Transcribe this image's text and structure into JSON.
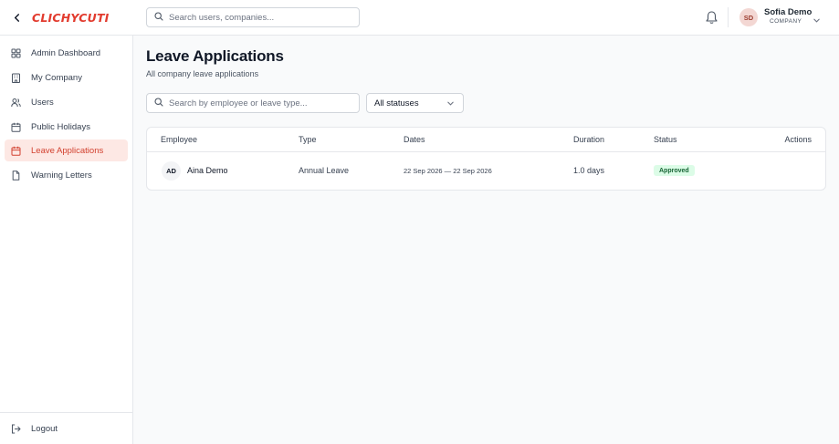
{
  "header": {
    "logo_text": "CLICHYCUTI",
    "search_placeholder": "Search users, companies...",
    "user": {
      "initials": "SD",
      "name": "Sofia Demo",
      "role": "COMPANY"
    }
  },
  "sidebar": {
    "items": [
      {
        "label": "Admin Dashboard",
        "icon": "dashboard-icon"
      },
      {
        "label": "My Company",
        "icon": "building-icon"
      },
      {
        "label": "Users",
        "icon": "users-icon"
      },
      {
        "label": "Public Holidays",
        "icon": "calendar-icon"
      },
      {
        "label": "Leave Applications",
        "icon": "calendar-icon",
        "active": true
      },
      {
        "label": "Warning Letters",
        "icon": "document-icon"
      }
    ],
    "logout_label": "Logout"
  },
  "main": {
    "title": "Leave Applications",
    "subtitle": "All company leave applications",
    "search_placeholder": "Search by employee or leave type...",
    "status_filter": "All statuses",
    "table": {
      "columns": [
        "Employee",
        "Type",
        "Dates",
        "Duration",
        "Status",
        "Actions"
      ],
      "rows": [
        {
          "initials": "AD",
          "employee": "Aina Demo",
          "type": "Annual Leave",
          "dates": "22 Sep 2026 — 22 Sep 2026",
          "duration": "1.0 days",
          "status": "Approved"
        }
      ]
    }
  },
  "colors": {
    "accent": "#d2412f",
    "active_bg": "#fde8e4",
    "approved_bg": "#dcfce7",
    "approved_text": "#166534"
  }
}
